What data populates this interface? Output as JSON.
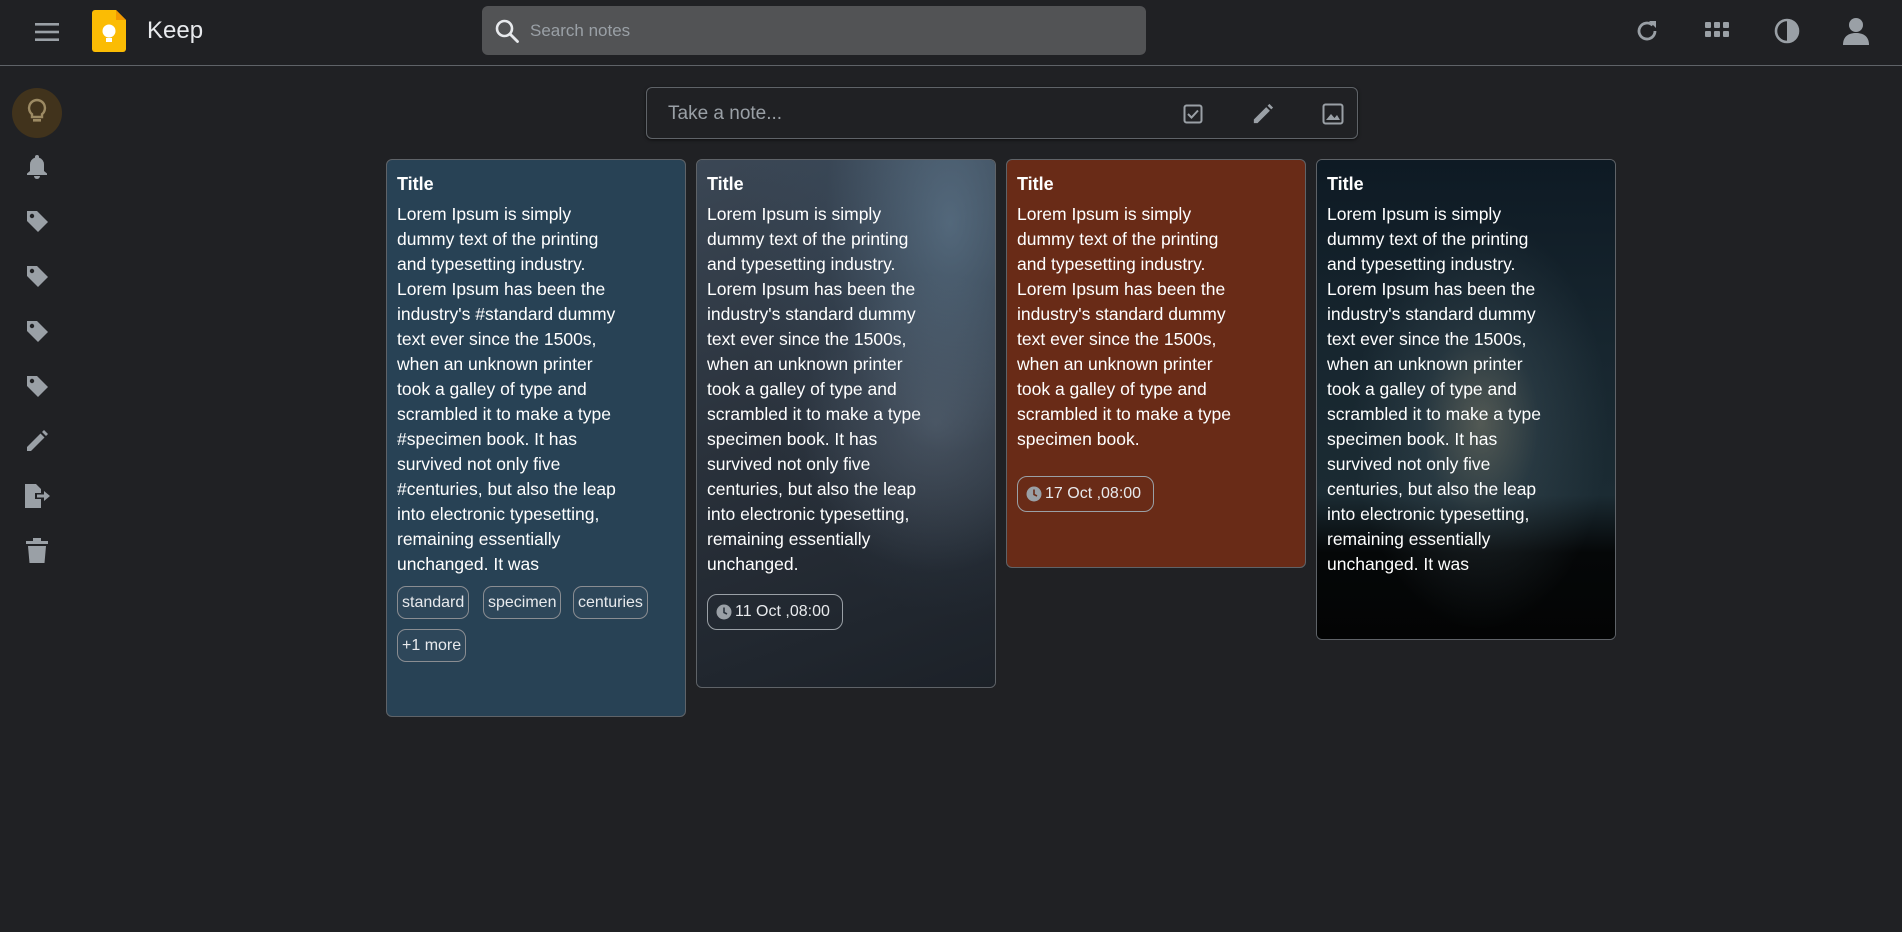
{
  "header": {
    "app_title": "Keep",
    "search_placeholder": "Search notes",
    "icons": [
      "menu-icon",
      "keep-logo",
      "search-icon",
      "refresh-icon",
      "apps-grid-icon",
      "theme-contrast-icon",
      "account-icon"
    ]
  },
  "sidebar": {
    "items": [
      {
        "name": "notes",
        "icon": "lightbulb-icon",
        "active": true
      },
      {
        "name": "reminders",
        "icon": "bell-icon"
      },
      {
        "name": "label-1",
        "icon": "label-icon"
      },
      {
        "name": "label-2",
        "icon": "label-icon"
      },
      {
        "name": "label-3",
        "icon": "label-icon"
      },
      {
        "name": "label-4",
        "icon": "label-icon"
      },
      {
        "name": "edit-labels",
        "icon": "pencil-icon"
      },
      {
        "name": "archive",
        "icon": "archive-export-icon"
      },
      {
        "name": "trash",
        "icon": "trash-icon"
      }
    ]
  },
  "take_note": {
    "placeholder": "Take a note...",
    "icons": [
      "checkbox-icon",
      "pencil-icon",
      "image-icon"
    ]
  },
  "colors": {
    "background": "#202124",
    "note_blue": "#284255",
    "note_brown": "#692b17",
    "accent_yellow": "#fbbc04"
  },
  "notes": [
    {
      "title": "Title",
      "line1": "Lorem Ipsum is simply",
      "line2": "dummy text of the printing",
      "line3": "and typesetting industry.",
      "line4": "Lorem Ipsum has been the",
      "line5": "industry's #standard dummy",
      "line6": "text ever since the 1500s,",
      "line7": "when an unknown printer",
      "line8": "took a galley of type and",
      "line9": "scrambled it to make a type",
      "line10": "#specimen book. It has",
      "line11": "survived not only five",
      "line12": "#centuries, but also the leap",
      "line13": "into electronic typesetting,",
      "line14": "remaining essentially",
      "line15": "unchanged. It was",
      "chips": [
        "standard",
        "specimen",
        "centuries",
        "+1 more"
      ]
    },
    {
      "title": "Title",
      "line1": "Lorem Ipsum is simply",
      "line2": "dummy text of the printing",
      "line3": "and typesetting industry.",
      "line4": "Lorem Ipsum has been the",
      "line5": "industry's standard dummy",
      "line6": "text ever since the 1500s,",
      "line7": "when an unknown printer",
      "line8": "took a galley of type and",
      "line9": "scrambled it to make a type",
      "line10": "specimen book. It has",
      "line11": "survived not only five",
      "line12": "centuries, but also the leap",
      "line13": "into electronic typesetting,",
      "line14": "remaining essentially",
      "line15": "unchanged.",
      "reminder": "11 Oct ,08:00"
    },
    {
      "title": "Title",
      "line1": "Lorem Ipsum is simply",
      "line2": "dummy text of the printing",
      "line3": "and typesetting industry.",
      "line4": "Lorem Ipsum has been the",
      "line5": "industry's standard dummy",
      "line6": "text ever since the 1500s,",
      "line7": "when an unknown printer",
      "line8": "took a galley of type and",
      "line9": "scrambled it to make a type",
      "line10": "specimen book.",
      "reminder": "17 Oct ,08:00"
    },
    {
      "title": "Title",
      "line1": "Lorem Ipsum is simply",
      "line2": "dummy text of the printing",
      "line3": "and typesetting industry.",
      "line4": "Lorem Ipsum has been the",
      "line5": "industry's standard dummy",
      "line6": "text ever since the 1500s,",
      "line7": "when an unknown printer",
      "line8": "took a galley of type and",
      "line9": "scrambled it to make a type",
      "line10": "specimen book. It has",
      "line11": "survived not only five",
      "line12": "centuries, but also the leap",
      "line13": "into electronic typesetting,",
      "line14": "remaining essentially",
      "line15": "unchanged. It was"
    }
  ]
}
